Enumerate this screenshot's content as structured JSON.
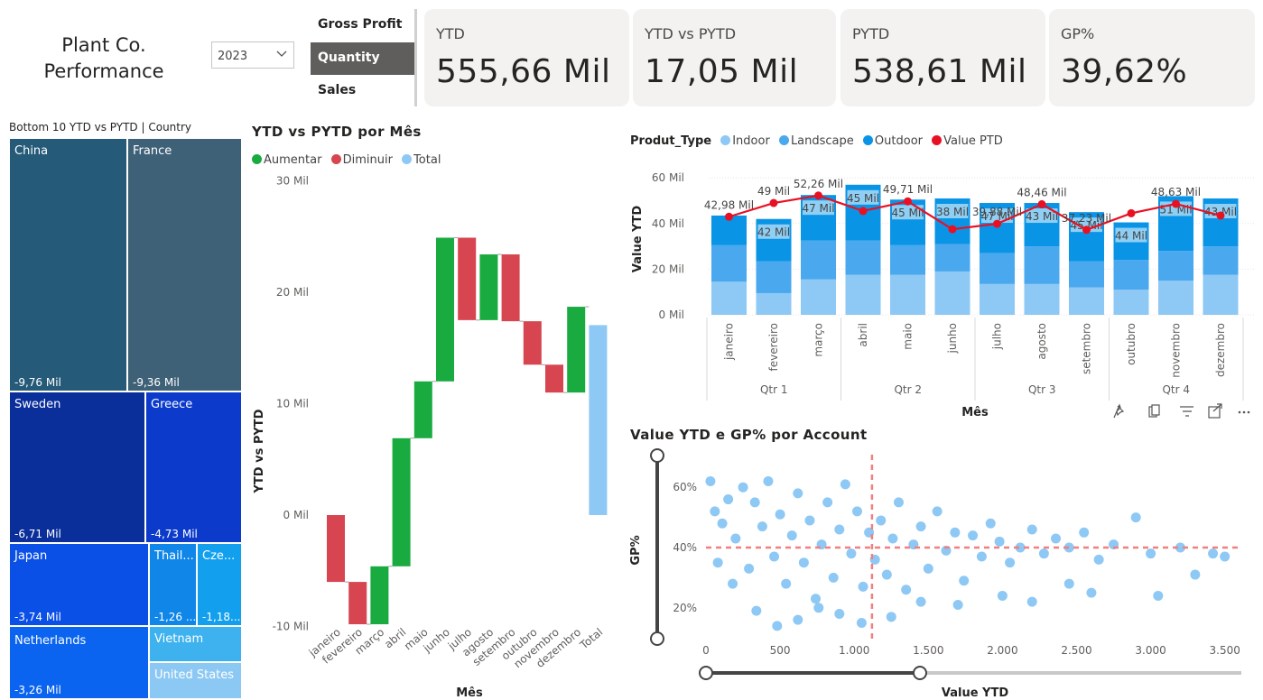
{
  "header": {
    "title_line1": "Plant Co.",
    "title_line2": "Performance",
    "year_select": "2023"
  },
  "metric_slicer": {
    "items": [
      {
        "label": "Gross Profit",
        "selected": false
      },
      {
        "label": "Quantity",
        "selected": true
      },
      {
        "label": "Sales",
        "selected": false
      }
    ]
  },
  "kpis": [
    {
      "label": "YTD",
      "value": "555,66 Mil"
    },
    {
      "label": "YTD vs PYTD",
      "value": "17,05 Mil"
    },
    {
      "label": "PYTD",
      "value": "538,61 Mil"
    },
    {
      "label": "GP%",
      "value": "39,62%"
    }
  ],
  "treemap": {
    "title": "Bottom 10 YTD vs PYTD | Country",
    "cells": [
      {
        "name": "China",
        "value": "-9,76 Mil",
        "color": "#255a78"
      },
      {
        "name": "France",
        "value": "-9,36 Mil",
        "color": "#3f6178"
      },
      {
        "name": "Sweden",
        "value": "-6,71 Mil",
        "color": "#0a2e9a"
      },
      {
        "name": "Greece",
        "value": "-4,73 Mil",
        "color": "#0c3bcb"
      },
      {
        "name": "Japan",
        "value": "-3,74 Mil",
        "color": "#0a4fe6"
      },
      {
        "name": "Thail...",
        "value": "-1,26 ...",
        "color": "#0f86e8"
      },
      {
        "name": "Cze...",
        "value": "-1,18...",
        "color": "#12a0ee"
      },
      {
        "name": "Netherlands",
        "value": "-3,26 Mil",
        "color": "#0a64ef"
      },
      {
        "name": "Vietnam",
        "value": "",
        "color": "#3eb2ee"
      },
      {
        "name": "United States",
        "value": "",
        "color": "#8cc8f4"
      }
    ]
  },
  "waterfall": {
    "title": "YTD vs PYTD por Mês",
    "legend": [
      {
        "label": "Aumentar",
        "color": "#1aab40"
      },
      {
        "label": "Diminuir",
        "color": "#d64550"
      },
      {
        "label": "Total",
        "color": "#8ec8f5"
      }
    ],
    "xlabel": "Mês",
    "ylabel": "YTD vs PYTD",
    "yticks": [
      "30 Mil",
      "20 Mil",
      "10 Mil",
      "0 Mil",
      "-10 Mil"
    ]
  },
  "combo": {
    "legend_title": "Produt_Type",
    "legend": [
      {
        "label": "Indoor",
        "color": "#8ec8f5"
      },
      {
        "label": "Landscape",
        "color": "#4aa8ee"
      },
      {
        "label": "Outdoor",
        "color": "#0a94e6"
      },
      {
        "label": "Value PTD",
        "color": "#e81123"
      }
    ],
    "ylabel": "Value YTD",
    "xlabel": "Mês",
    "yticks": [
      "60 Mil",
      "40 Mil",
      "20 Mil",
      "0 Mil"
    ],
    "quarters": [
      "Qtr 1",
      "Qtr 2",
      "Qtr 3",
      "Qtr 4"
    ],
    "bar_labels": [
      "",
      "42 Mil",
      "47 Mil",
      "45 Mil",
      "45 Mil",
      "38 Mil",
      "47 Mil",
      "43 Mil",
      "45 Mil",
      "44 Mil",
      "51 Mil",
      "43 Mil"
    ],
    "line_labels": [
      "42,98 Mil",
      "49 Mil",
      "52,26 Mil",
      "",
      "49,71 Mil",
      "",
      "39,88 Mil",
      "48,46 Mil",
      "37,23 Mil",
      "",
      "48,63 Mil",
      ""
    ]
  },
  "scatter": {
    "title": "Value YTD e GP% por Account",
    "ylabel": "GP%",
    "xlabel": "Value YTD",
    "yticks": [
      "60%",
      "40%",
      "20%"
    ],
    "xticks": [
      "0",
      "500",
      "1.000",
      "1.500",
      "2.000",
      "2.500",
      "3.000",
      "3.500"
    ]
  },
  "toolbar": {
    "icons": [
      "pin-icon",
      "copy-icon",
      "filter-icon",
      "expand-icon",
      "more-icon"
    ]
  },
  "chart_data": [
    {
      "type": "bar",
      "title": "YTD vs PYTD por Mês",
      "xlabel": "Mês",
      "ylabel": "YTD vs PYTD",
      "ylim": [
        -10,
        30
      ],
      "categories": [
        "janeiro",
        "fevereiro",
        "março",
        "abril",
        "maio",
        "junho",
        "julho",
        "agosto",
        "setembro",
        "outubro",
        "novembro",
        "dezembro",
        "Total"
      ],
      "series": [
        {
          "name": "YTD vs PYTD",
          "values": [
            -6.0,
            -3.8,
            5.2,
            11.5,
            5.1,
            12.9,
            -7.4,
            5.9,
            -6.0,
            -3.9,
            -2.5,
            7.7,
            17.05
          ]
        }
      ]
    },
    {
      "type": "bar",
      "xlabel": "Mês",
      "ylabel": "Value YTD",
      "ylim": [
        0,
        60
      ],
      "categories": [
        "janeiro",
        "fevereiro",
        "março",
        "abril",
        "maio",
        "junho",
        "julho",
        "agosto",
        "setembro",
        "outubro",
        "novembro",
        "dezembro"
      ],
      "series": [
        {
          "name": "Indoor",
          "values": [
            14.5,
            9.5,
            15.5,
            17.5,
            17.5,
            19.0,
            13.5,
            13.5,
            12.0,
            11.0,
            15.0,
            17.5
          ]
        },
        {
          "name": "Landscape",
          "values": [
            16.0,
            14.0,
            17.0,
            15.0,
            13.0,
            12.0,
            13.5,
            16.5,
            11.5,
            13.0,
            13.0,
            12.5
          ]
        },
        {
          "name": "Outdoor",
          "values": [
            13.0,
            18.5,
            20.0,
            24.5,
            20.0,
            20.0,
            22.0,
            19.0,
            21.5,
            16.5,
            24.0,
            21.0
          ]
        },
        {
          "name": "Value PTD",
          "values": [
            42.98,
            49,
            52.26,
            45.5,
            49.71,
            37.5,
            39.88,
            48.46,
            37.23,
            44.5,
            48.63,
            43.5
          ]
        }
      ]
    },
    {
      "type": "scatter",
      "title": "Value YTD e GP% por Account",
      "xlabel": "Value YTD",
      "ylabel": "GP%",
      "xlim": [
        0,
        3600
      ],
      "ylim": [
        10,
        70
      ],
      "reference_lines": {
        "x": 1120,
        "y": 40
      },
      "points": [
        [
          30,
          62
        ],
        [
          60,
          52
        ],
        [
          110,
          48
        ],
        [
          150,
          56
        ],
        [
          200,
          43
        ],
        [
          250,
          60
        ],
        [
          290,
          33
        ],
        [
          330,
          55
        ],
        [
          380,
          47
        ],
        [
          420,
          62
        ],
        [
          460,
          37
        ],
        [
          500,
          51
        ],
        [
          540,
          28
        ],
        [
          580,
          44
        ],
        [
          620,
          58
        ],
        [
          660,
          35
        ],
        [
          700,
          49
        ],
        [
          740,
          23
        ],
        [
          780,
          41
        ],
        [
          820,
          55
        ],
        [
          860,
          30
        ],
        [
          900,
          46
        ],
        [
          940,
          61
        ],
        [
          980,
          38
        ],
        [
          1020,
          52
        ],
        [
          1060,
          27
        ],
        [
          1100,
          45
        ],
        [
          1140,
          36
        ],
        [
          1180,
          49
        ],
        [
          1220,
          31
        ],
        [
          1260,
          43
        ],
        [
          1300,
          55
        ],
        [
          1350,
          26
        ],
        [
          1400,
          41
        ],
        [
          1450,
          47
        ],
        [
          1500,
          33
        ],
        [
          1560,
          52
        ],
        [
          1620,
          39
        ],
        [
          1680,
          45
        ],
        [
          1740,
          29
        ],
        [
          1800,
          44
        ],
        [
          1860,
          37
        ],
        [
          1920,
          48
        ],
        [
          1980,
          42
        ],
        [
          2050,
          35
        ],
        [
          2120,
          40
        ],
        [
          2200,
          46
        ],
        [
          2280,
          38
        ],
        [
          2360,
          43
        ],
        [
          2450,
          40
        ],
        [
          2550,
          45
        ],
        [
          2650,
          36
        ],
        [
          2750,
          41
        ],
        [
          2900,
          50
        ],
        [
          3000,
          38
        ],
        [
          3200,
          40
        ],
        [
          3300,
          31
        ],
        [
          3420,
          38
        ],
        [
          3500,
          37
        ],
        [
          80,
          35
        ],
        [
          180,
          28
        ],
        [
          340,
          19
        ],
        [
          480,
          14
        ],
        [
          620,
          16
        ],
        [
          760,
          20
        ],
        [
          900,
          18
        ],
        [
          1050,
          15
        ],
        [
          1250,
          17
        ],
        [
          1450,
          22
        ],
        [
          1700,
          21
        ],
        [
          2000,
          24
        ],
        [
          2200,
          22
        ],
        [
          2450,
          28
        ],
        [
          2600,
          25
        ],
        [
          3050,
          24
        ]
      ]
    }
  ]
}
